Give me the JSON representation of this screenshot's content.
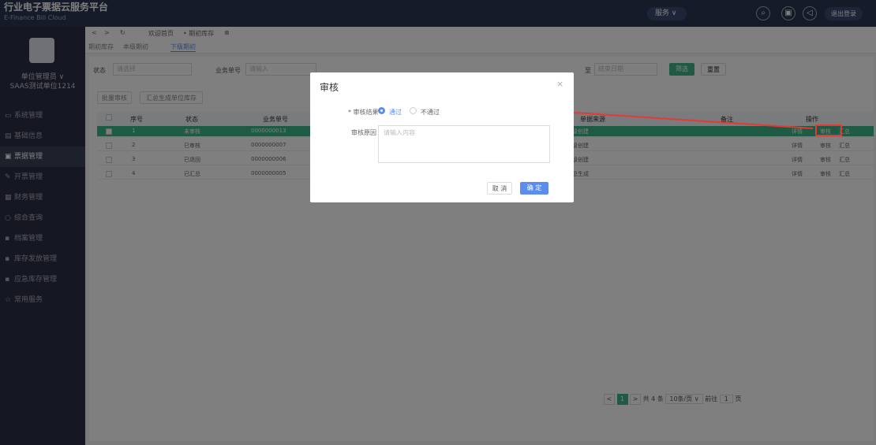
{
  "header": {
    "title": "行业电子票据云服务平台",
    "subtitle": "E-Finance Bill Cloud",
    "service": "服务 ∨",
    "logout": "退出登录"
  },
  "sidebar": {
    "user": "单位管理员 ∨",
    "org": "SAAS测试单位1214",
    "items": [
      "系统管理",
      "基础信息",
      "票据管理",
      "开票管理",
      "财务管理",
      "综合查询",
      "档案管理",
      "库存发放管理",
      "应急库存管理",
      "常用服务"
    ]
  },
  "nav": {
    "back": "<",
    "fwd": ">",
    "refresh": "↻",
    "tab_home": "欢迎首页",
    "tab_current": "• 期初库存",
    "tab_close": "⊗"
  },
  "subtabs": [
    "期初库存",
    "本级期初",
    "下级期初"
  ],
  "filters": {
    "status_label": "状态",
    "status_placeholder": "请选择",
    "biz_label": "业务单号",
    "biz_placeholder": "请输入",
    "end_date_placeholder": "结束日期",
    "date_sep": "至",
    "query": "筛选",
    "reset": "重置",
    "batch_audit": "批量审核",
    "batch_summary": "汇总生成单位库存"
  },
  "table": {
    "headers": [
      "序号",
      "状态",
      "业务单号",
      "单据来源",
      "备注",
      "操作"
    ],
    "rows": [
      {
        "no": "1",
        "status": "未审核",
        "biz": "0000000013",
        "source": "本级创建",
        "actions": [
          "详情",
          "审核",
          "汇总"
        ]
      },
      {
        "no": "2",
        "status": "已审核",
        "biz": "0000000007",
        "source": "本级创建",
        "actions": [
          "详情",
          "审核",
          "汇总"
        ]
      },
      {
        "no": "3",
        "status": "已退回",
        "biz": "0000000006",
        "source": "本级创建",
        "actions": [
          "详情",
          "审核",
          "汇总"
        ]
      },
      {
        "no": "4",
        "status": "已汇总",
        "biz": "0000000005",
        "source": "汇总生成",
        "actions": [
          "详情",
          "审核",
          "汇总"
        ]
      }
    ]
  },
  "pager": {
    "prev": "<",
    "page": "1",
    "next": ">",
    "total": "共 4 条",
    "size": "10条/页 ∨",
    "goto": "前往",
    "goto_page": "1",
    "unit": "页"
  },
  "dialog": {
    "title": "审核",
    "close": "×",
    "result_label": "* 审核结果",
    "pass": "通过",
    "reject": "不通过",
    "reason_label": "审核原因",
    "reason_placeholder": "请输入内容",
    "cancel": "取 消",
    "ok": "确 定"
  },
  "colors": {
    "accent": "#3fb489",
    "primary": "#5b8def",
    "highlight": "#e53935"
  }
}
